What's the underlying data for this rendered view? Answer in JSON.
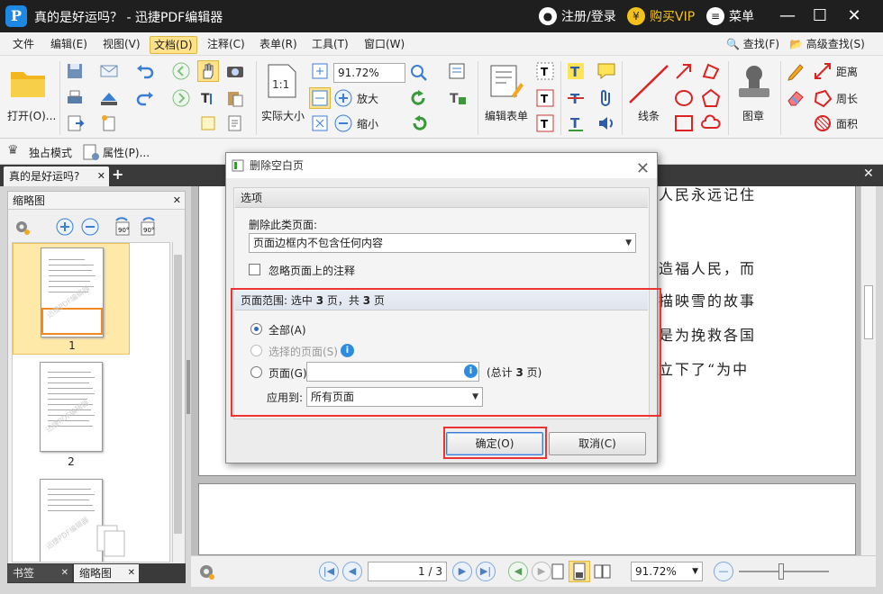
{
  "app": {
    "logo_letter": "P",
    "title": "真的是好运吗？ - 迅捷PDF编辑器",
    "login": "注册/登录",
    "vip": "购买VIP",
    "menu": "菜单"
  },
  "menubar": {
    "items": [
      "文件",
      "编辑(E)",
      "视图(V)",
      "文档(D)",
      "注释(C)",
      "表单(R)",
      "工具(T)",
      "窗口(W)"
    ],
    "active": "文档(D)",
    "find": "查找(F)",
    "advanced_find": "高级查找(S)"
  },
  "ribbon": {
    "open": "打开(O)...",
    "actual_size": "实际大小",
    "zoom": "91.72%",
    "zoom_in": "放大",
    "zoom_out": "缩小",
    "edit_form": "编辑表单",
    "line": "线条",
    "stamp": "图章",
    "distance": "距离",
    "perimeter": "周长",
    "area": "面积"
  },
  "toolbar2": {
    "exclusive_mode": "独占模式",
    "properties": "属性(P)..."
  },
  "doc_tab": {
    "label": "真的是好运吗?"
  },
  "sidebar": {
    "title": "缩略图",
    "watermark": "迅捷PDF编辑器",
    "pages": [
      "1",
      "2"
    ],
    "bottom_tabs": [
      "书签",
      "缩略图"
    ]
  },
  "page_text": {
    "lines": [
      "人民永远记住",
      "造福人民，而",
      "描映雪的故事",
      "是为挽救各国",
      "立下了“为中"
    ]
  },
  "navbar": {
    "page": "1",
    "total": "3",
    "zoom": "91.72%"
  },
  "dialog": {
    "title": "删除空白页",
    "options_header": "选项",
    "delete_type_label": "删除此类页面:",
    "delete_type_value": "页面边框内不包含任何内容",
    "ignore_annotations": "忽略页面上的注释",
    "range_prefix": "页面范围: 选中 ",
    "range_selected": "3",
    "range_mid": " 页，共 ",
    "range_total": "3",
    "range_suffix": " 页",
    "radio_all": "全部(A)",
    "radio_selected": "选择的页面(S)",
    "radio_pages": "页面(G)",
    "pages_total_prefix": "(总计 ",
    "pages_total_num": "3",
    "pages_total_suffix": " 页)",
    "apply_to_label": "应用到:",
    "apply_to_value": "所有页面",
    "ok": "确定(O)",
    "cancel": "取消(C)"
  },
  "colors": {
    "title_bg": "#1f1f1f",
    "active_menu": "#ffe28a",
    "highlight_red": "#e33333",
    "info_blue": "#2d8ce0"
  }
}
